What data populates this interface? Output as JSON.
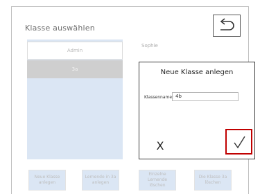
{
  "header": {
    "title": "Klasse auswählen"
  },
  "class_list": {
    "items": [
      {
        "label": "Admin"
      },
      {
        "label": "3a"
      }
    ]
  },
  "students": {
    "first": "Sophie"
  },
  "dialog": {
    "title": "Neue Klasse anlegen",
    "field_label": "Klassenname:",
    "field_value": "4b",
    "cancel_label": "X"
  },
  "bottom": {
    "new_class": "Neue Klasse anlegen",
    "add_students": "Lernende in 3a anlegen",
    "delete_students": "Einzelne Lernende löschen",
    "delete_class": "Die Klasse 3a löschen"
  },
  "colors": {
    "accent_confirm": "#c00000",
    "list_bg": "#dbe6f4",
    "selected_item": "#cfcfcf"
  },
  "icons": {
    "back": "undo-arrow-icon",
    "confirm": "checkmark-icon"
  }
}
